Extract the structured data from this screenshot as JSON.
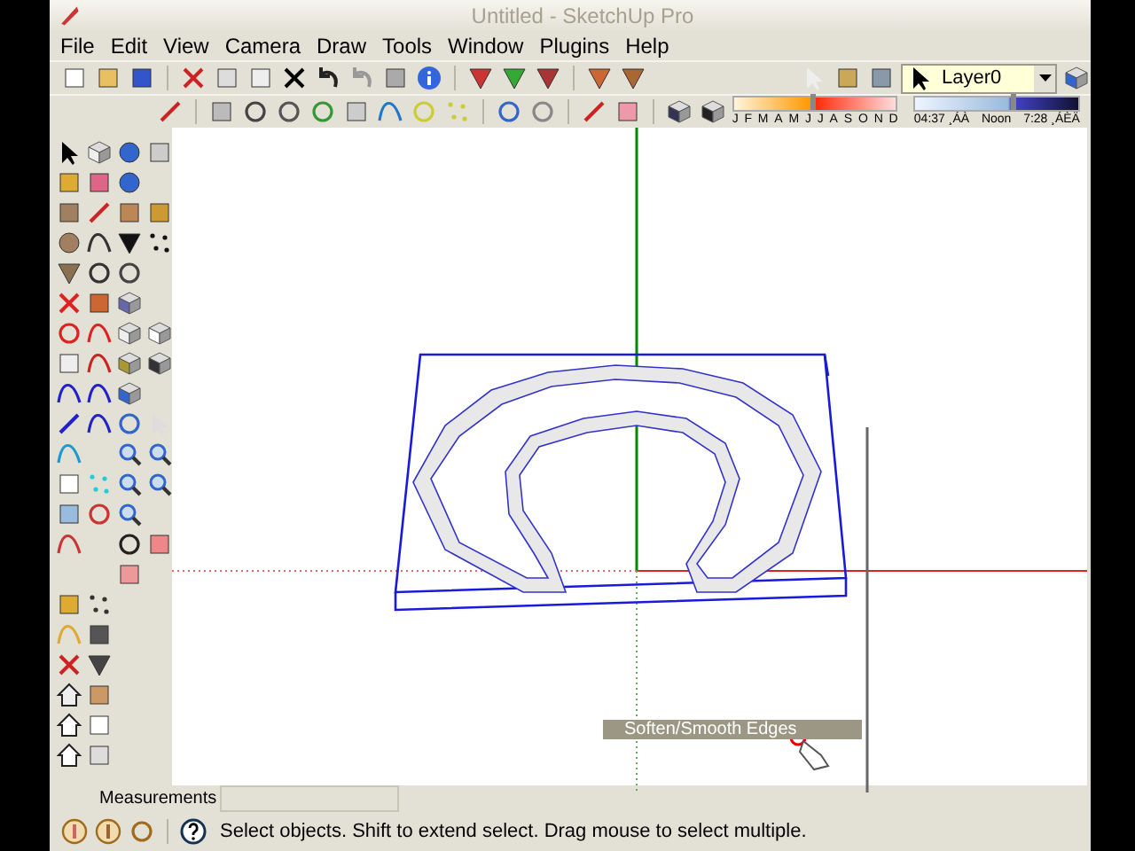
{
  "window": {
    "title": "Untitled - SketchUp Pro"
  },
  "menu": [
    {
      "label": "File"
    },
    {
      "label": "Edit"
    },
    {
      "label": "View"
    },
    {
      "label": "Camera"
    },
    {
      "label": "Draw"
    },
    {
      "label": "Tools"
    },
    {
      "label": "Window"
    },
    {
      "label": "Plugins"
    },
    {
      "label": "Help"
    }
  ],
  "layers": {
    "value": "Layer0"
  },
  "shadows": {
    "months": [
      "J",
      "F",
      "M",
      "A",
      "M",
      "J",
      "J",
      "A",
      "S",
      "O",
      "N",
      "D"
    ],
    "date_slider": {
      "level": 0.47
    },
    "time_start": "04:37 ¸ÁÀ",
    "time_mid": "Noon",
    "time_end": "7:28 ¸ÁÈÄ",
    "time_slider": {
      "level": 0.58
    }
  },
  "tooltip": {
    "label": "Soften/Smooth Edges"
  },
  "measurements": {
    "label": "Measurements"
  },
  "status_bar": {
    "text": "Select objects. Shift to extend select. Drag mouse to select multiple."
  }
}
